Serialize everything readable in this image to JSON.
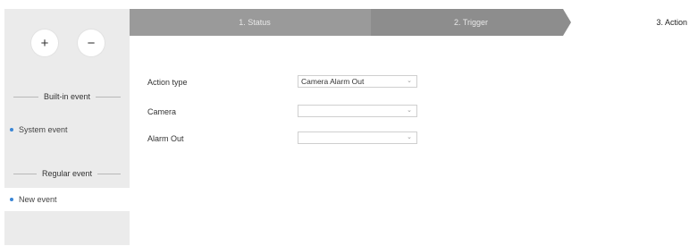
{
  "sidebar": {
    "add_label": "+",
    "remove_label": "−",
    "builtin_heading": "Built-in event",
    "builtin_items": [
      {
        "label": "System event"
      }
    ],
    "regular_heading": "Regular event",
    "regular_items": [
      {
        "label": "New event"
      }
    ]
  },
  "steps": [
    {
      "label": "1. Status"
    },
    {
      "label": "2. Trigger"
    },
    {
      "label": "3. Action"
    }
  ],
  "form": {
    "action_type": {
      "label": "Action type",
      "value": "Camera Alarm Out"
    },
    "camera": {
      "label": "Camera",
      "value": ""
    },
    "alarm_out": {
      "label": "Alarm Out",
      "value": ""
    }
  },
  "icons": {
    "dropdown": "chevron-down-icon"
  },
  "colors": {
    "accent": "#3a86d6",
    "stepbar": "#9a9a9a",
    "sidebar_bg": "#ebebeb"
  }
}
